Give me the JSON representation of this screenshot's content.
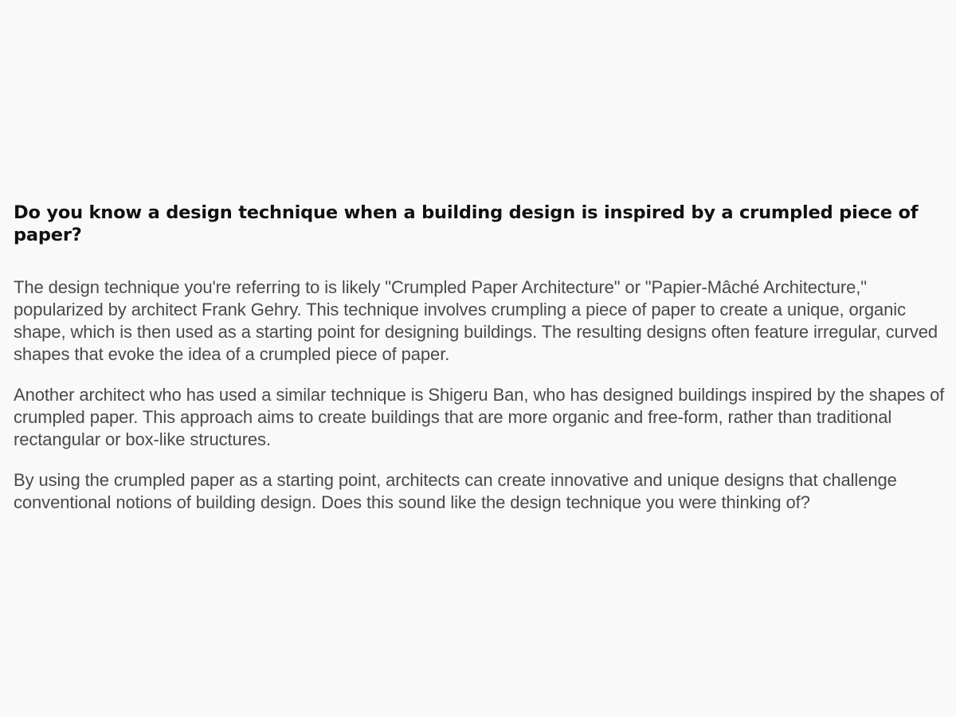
{
  "question": "Do you know a design technique when a building design is inspired by a crumpled piece of paper?",
  "answer": {
    "paragraphs": [
      "The design technique you're referring to is likely \"Crumpled Paper Architecture\" or \"Papier-Mâché Architecture,\" popularized by architect Frank Gehry. This technique involves crumpling a piece of paper to create a unique, organic shape, which is then used as a starting point for designing buildings. The resulting designs often feature irregular, curved shapes that evoke the idea of a crumpled piece of paper.",
      "Another architect who has used a similar technique is Shigeru Ban, who has designed buildings inspired by the shapes of crumpled paper. This approach aims to create buildings that are more organic and free-form, rather than traditional rectangular or box-like structures.",
      "By using the crumpled paper as a starting point, architects can create innovative and unique designs that challenge conventional notions of building design. Does this sound like the design technique you were thinking of?"
    ]
  }
}
